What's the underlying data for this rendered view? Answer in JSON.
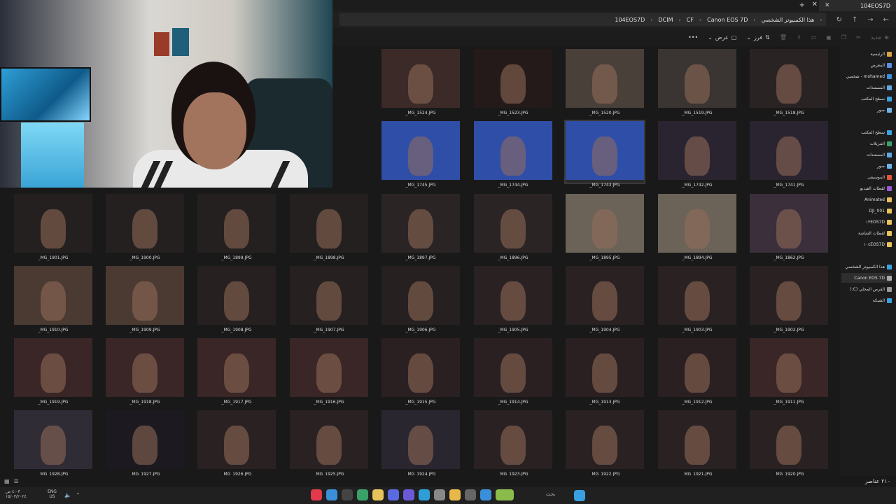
{
  "titlebar": {
    "tab_title": "104EOS7D",
    "tab_close": "✕",
    "new_tab": "+",
    "window_close": "✕"
  },
  "address": {
    "crumbs": [
      "هذا الكمبيوتر الشخصي",
      "Canon EOS 7D",
      "CF",
      "DCIM",
      "104EOS7D"
    ],
    "nav_back": "←",
    "nav_forward": "→",
    "nav_up": "↑",
    "refresh": "↻"
  },
  "command_bar": {
    "new_label": "جديد",
    "sort_label": "فرز",
    "view_label": "عرض",
    "more_label": "•••"
  },
  "sidebar": {
    "items": [
      {
        "label": "الرئيسية",
        "color": "#d9a441"
      },
      {
        "label": "المعرض",
        "color": "#5b8de0"
      },
      {
        "label": "mohamed - شخصي",
        "color": "#3a8fd8"
      },
      {
        "label": "المستندات",
        "color": "#5fa8e6"
      },
      {
        "label": "سطح المكتب",
        "color": "#3aa0e0"
      },
      {
        "label": "صور",
        "color": "#6eb3e8"
      },
      {
        "label": "سطح المكتب",
        "color": "#3aa0e0"
      },
      {
        "label": "التنزيلات",
        "color": "#3aa06a"
      },
      {
        "label": "المستندات",
        "color": "#5fa8e6"
      },
      {
        "label": "صور",
        "color": "#6eb3e8"
      },
      {
        "label": "الموسيقى",
        "color": "#e0563a"
      },
      {
        "label": "لقطات الفيديو",
        "color": "#9a5ad8"
      },
      {
        "label": "Animated",
        "color": "#e8c25a"
      },
      {
        "label": "DJI_001",
        "color": "#e8c25a"
      },
      {
        "label": "١٣EOS7D",
        "color": "#e8c25a"
      },
      {
        "label": "لقطات الشاشة",
        "color": "#e8c25a"
      },
      {
        "label": "١٠٤EOS7D",
        "color": "#e8c25a"
      },
      {
        "label": "هذا الكمبيوتر الشخصي",
        "color": "#3aa0e0"
      },
      {
        "label": "Canon EOS 7D",
        "color": "#aaaaaa"
      },
      {
        "label": "القرص المحلي (C:)",
        "color": "#999999"
      },
      {
        "label": "الشبكة",
        "color": "#3aa0e0"
      }
    ]
  },
  "files": [
    {
      "name": "_MG_1524.JPG",
      "tone": "#3b2a28"
    },
    {
      "name": "_MG_1523.JPG",
      "tone": "#241a1a"
    },
    {
      "name": "_MG_1520.JPG",
      "tone": "#4a403a"
    },
    {
      "name": "_MG_1519.JPG",
      "tone": "#3a3432"
    },
    {
      "name": "_MG_1518.JPG",
      "tone": "#2a2324"
    },
    {
      "name": "_MG_1745.JPG",
      "tone": "#2f4ea8"
    },
    {
      "name": "_MG_1744.JPG",
      "tone": "#2f4ea8"
    },
    {
      "name": "_MG_1743.JPG",
      "tone": "#2f4ea8"
    },
    {
      "name": "_MG_1742.JPG",
      "tone": "#2a2430"
    },
    {
      "name": "_MG_1741.JPG",
      "tone": "#2a2430"
    },
    {
      "name": "_MG_1901.JPG",
      "tone": "#252020"
    },
    {
      "name": "_MG_1900.JPG",
      "tone": "#252020"
    },
    {
      "name": "_MG_1899.JPG",
      "tone": "#252020"
    },
    {
      "name": "_MG_1898.JPG",
      "tone": "#252020"
    },
    {
      "name": "_MG_1897.JPG",
      "tone": "#2a2424"
    },
    {
      "name": "_MG_1896.JPG",
      "tone": "#2a2424"
    },
    {
      "name": "_MG_1895.JPG",
      "tone": "#6b6258"
    },
    {
      "name": "_MG_1894.JPG",
      "tone": "#6b6258"
    },
    {
      "name": "_MG_1862.JPG",
      "tone": "#3a2f3a"
    },
    {
      "name": "_MG_1910.JPG",
      "tone": "#4a3a32"
    },
    {
      "name": "_MG_1909.JPG",
      "tone": "#4a3a32"
    },
    {
      "name": "_MG_1908.JPG",
      "tone": "#262020"
    },
    {
      "name": "_MG_1907.JPG",
      "tone": "#262020"
    },
    {
      "name": "_MG_1906.JPG",
      "tone": "#262020"
    },
    {
      "name": "_MG_1905.JPG",
      "tone": "#2a2222"
    },
    {
      "name": "_MG_1904.JPG",
      "tone": "#2a2222"
    },
    {
      "name": "_MG_1903.JPG",
      "tone": "#2a2222"
    },
    {
      "name": "_MG_1902.JPG",
      "tone": "#2a2222"
    },
    {
      "name": "_MG_1919.JPG",
      "tone": "#3a2626"
    },
    {
      "name": "_MG_1918.JPG",
      "tone": "#3a2626"
    },
    {
      "name": "_MG_1917.JPG",
      "tone": "#3a2626"
    },
    {
      "name": "_MG_1916.JPG",
      "tone": "#3a2626"
    },
    {
      "name": "_MG_1915.JPG",
      "tone": "#2a2022"
    },
    {
      "name": "_MG_1914.JPG",
      "tone": "#2a2022"
    },
    {
      "name": "_MG_1913.JPG",
      "tone": "#2a2022"
    },
    {
      "name": "_MG_1912.JPG",
      "tone": "#2a2022"
    },
    {
      "name": "_MG_1911.JPG",
      "tone": "#3a2626"
    },
    {
      "name": "_MG_1928.JPG",
      "tone": "#302c36"
    },
    {
      "name": "_MG_1927.JPG",
      "tone": "#1c1a20"
    },
    {
      "name": "_MG_1926.JPG",
      "tone": "#2a2222"
    },
    {
      "name": "_MG_1925.JPG",
      "tone": "#2a2222"
    },
    {
      "name": "_MG_1924.JPG",
      "tone": "#2a2630"
    },
    {
      "name": "_MG_1923.JPG",
      "tone": "#2a2222"
    },
    {
      "name": "_MG_1922.JPG",
      "tone": "#2a2222"
    },
    {
      "name": "_MG_1921.JPG",
      "tone": "#2a2222"
    },
    {
      "name": "_MG_1920.JPG",
      "tone": "#2a2222"
    }
  ],
  "status": {
    "item_count": "٢١٠ عناصر"
  },
  "taskbar": {
    "time": "٤:٠٣ ص",
    "date": "١٥/٠٣/٢٠٢٤",
    "lang_line1": "ENG",
    "lang_line2": "US",
    "search_label": "بحث"
  },
  "colors": {
    "accent": "#3a8fd8",
    "background": "#191919"
  }
}
